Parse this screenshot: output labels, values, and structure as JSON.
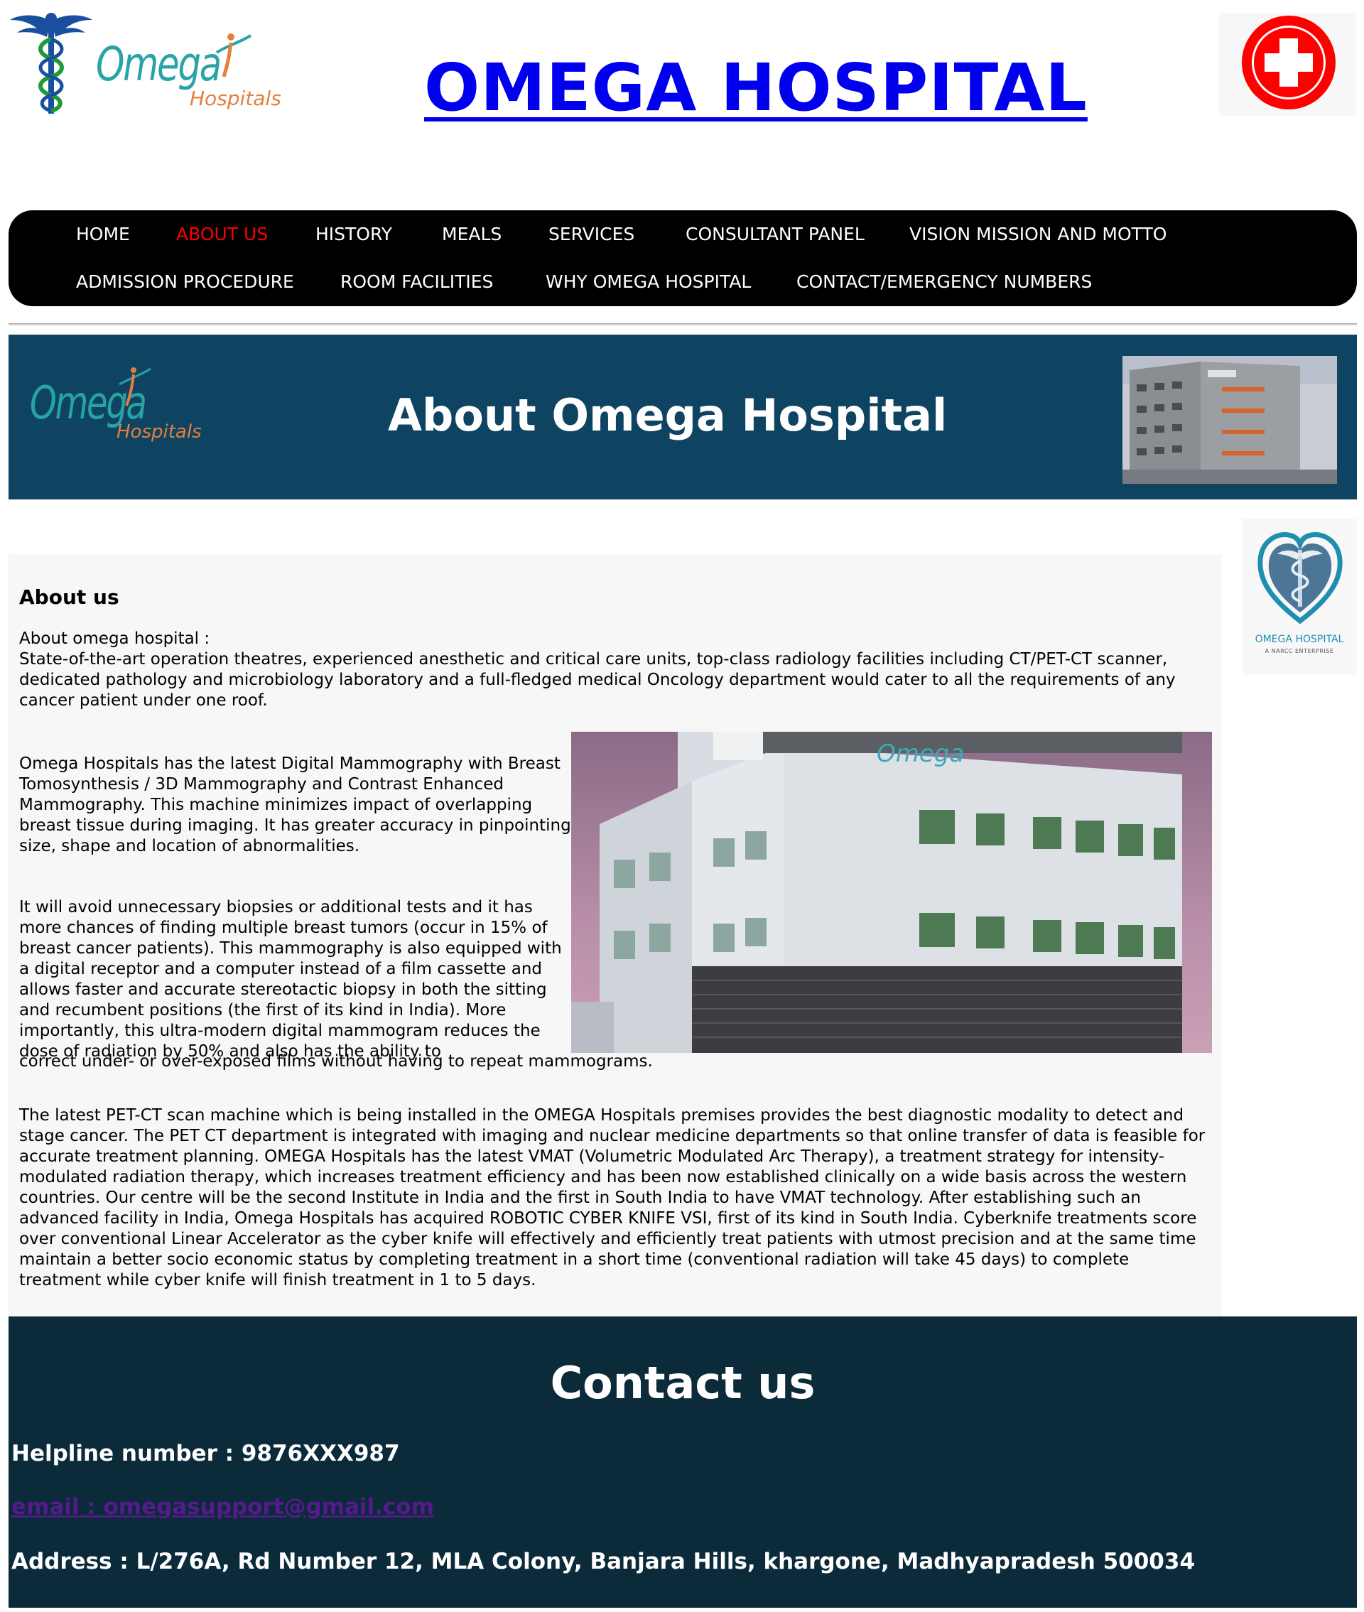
{
  "header": {
    "logo": {
      "word": "Omega",
      "sub": "Hospitals"
    },
    "title": "OMEGA HOSPITAL"
  },
  "nav": {
    "items": [
      {
        "label": "HOME"
      },
      {
        "label": "ABOUT US",
        "active": true
      },
      {
        "label": "HISTORY"
      },
      {
        "label": "MEALS"
      },
      {
        "label": "SERVICES"
      },
      {
        "label": "CONSULTANT PANEL"
      },
      {
        "label": "VISION MISSION AND MOTTO"
      },
      {
        "label": "ADMISSION PROCEDURE"
      },
      {
        "label": "ROOM FACILITIES"
      },
      {
        "label": "WHY OMEGA HOSPITAL"
      },
      {
        "label": "CONTACT/EMERGENCY NUMBERS"
      }
    ],
    "active_color": "#ff0000"
  },
  "banner": {
    "logo": {
      "word": "Omega",
      "sub": "Hospitals"
    },
    "title": "About Omega Hospital",
    "background": "#0e4462"
  },
  "side_logo": {
    "name": "OMEGA HOSPITAL",
    "sub": "A NARCC ENTERPRISE"
  },
  "article": {
    "heading": "About us",
    "intro_label": "About omega hospital :",
    "intro": "State-of-the-art operation theatres, experienced anesthetic and critical care units, top-class radiology facilities including CT/PET-CT scanner, dedicated pathology and microbiology laboratory and a full-fledged medical Oncology department would cater to all the requirements of any cancer patient under one roof.",
    "mammography": "Omega Hospitals has the latest Digital Mammography with Breast Tomosynthesis / 3D Mammography and Contrast Enhanced Mammography. This machine minimizes impact of overlapping breast tissue during imaging. It has greater accuracy in pinpointing size, shape and location of abnormalities.",
    "biopsy": "It will avoid unnecessary biopsies or additional tests and it has more chances of finding multiple breast tumors (occur in 15% of breast cancer patients). This mammography is also equipped with a digital receptor and a computer instead of a film cassette and allows faster and accurate stereotactic biopsy in both the sitting and recumbent positions (the first of its kind in India). More importantly, this ultra-modern digital mammogram reduces the dose of radiation by 50% and also has the ability to",
    "biopsy_tail": "correct under- or over-exposed films without having to repeat mammograms.",
    "petct": "The latest PET-CT scan machine which is being installed in the OMEGA Hospitals premises provides the best diagnostic modality to detect and stage cancer. The PET CT department is integrated with imaging and nuclear medicine departments so that online transfer of data is feasible for accurate treatment planning. OMEGA Hospitals has the latest VMAT (Volumetric Modulated Arc Therapy), a treatment strategy for intensity-modulated radiation therapy, which increases treatment efficiency and has been now established clinically on a wide basis across the western countries. Our centre will be the second Institute in India and the first in South India to have VMAT technology. After establishing such an advanced facility in India, Omega Hospitals has acquired ROBOTIC CYBER KNIFE VSI, first of its kind in South India. Cyberknife treatments score over conventional Linear Accelerator as the cyber knife will effectively and efficiently treat patients with utmost precision and at the same time maintain a better socio economic status by completing treatment in a short time (conventional radiation will take 45 days) to complete treatment while cyber knife will finish treatment in 1 to 5 days.",
    "photo_sign": "Omega"
  },
  "contact": {
    "title": "Contact us",
    "helpline": "Helpline number : 9876XXX987",
    "email": "email : omegasupport@gmail.com",
    "address": "Address : L/276A, Rd Number 12, MLA Colony, Banjara Hills, khargone, Madhyapradesh 500034",
    "background": "#0b2a3a"
  }
}
